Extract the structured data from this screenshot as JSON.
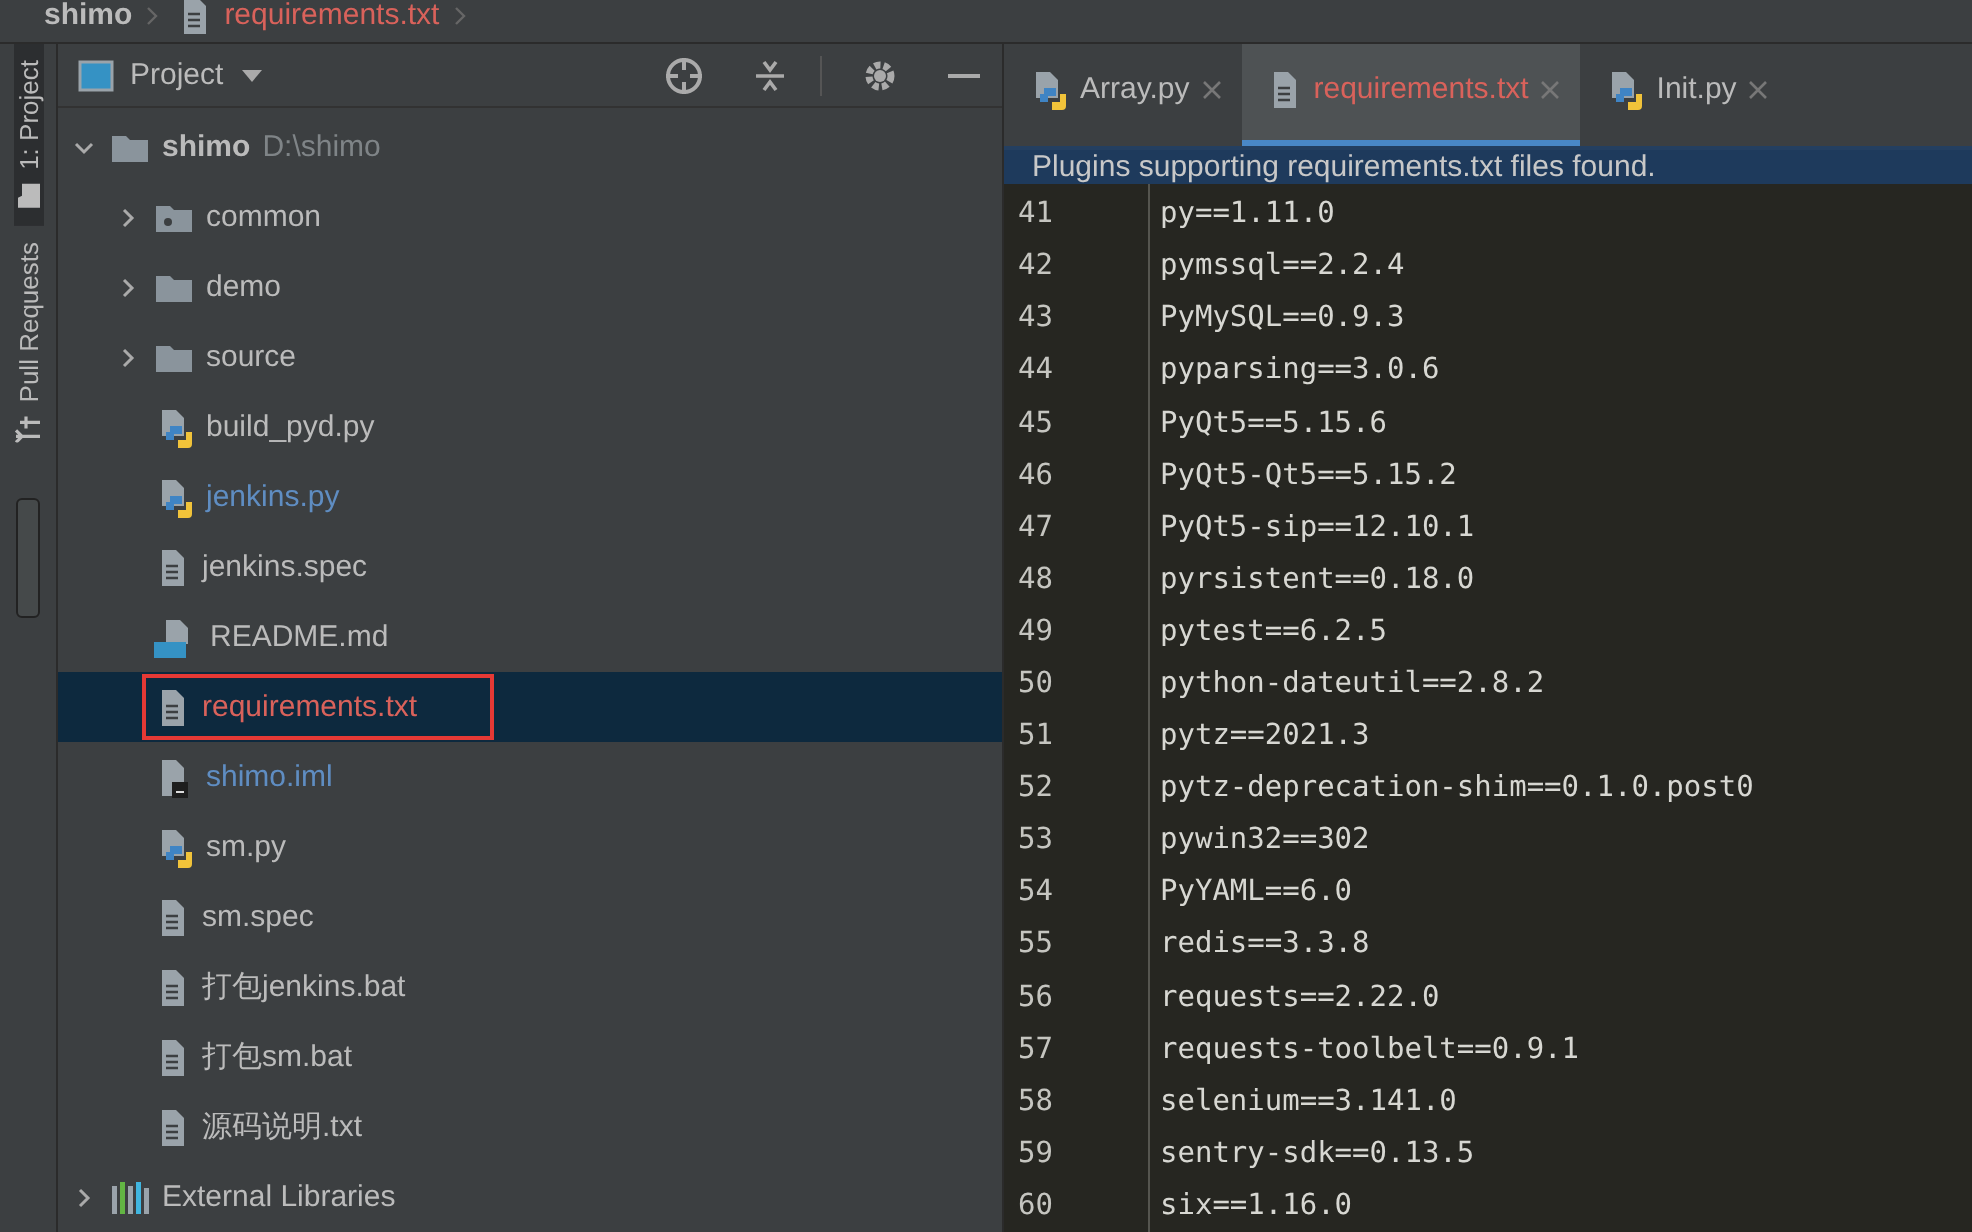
{
  "breadcrumb": [
    {
      "label": "shimo"
    },
    {
      "label": "requirements.txt",
      "kind": "text"
    }
  ],
  "tool_strip": [
    {
      "label": "1: Project",
      "kind": "project",
      "selected": true
    },
    {
      "label": "Pull Requests",
      "kind": "pull",
      "selected": false
    }
  ],
  "project_panel": {
    "title": "Project",
    "tree": [
      {
        "label": "shimo",
        "path": "D:\\shimo",
        "kind": "folder",
        "expanded": true,
        "selected": false,
        "children": [
          {
            "label": "common",
            "kind": "package",
            "expanded": false,
            "selected": false
          },
          {
            "label": "demo",
            "kind": "folder",
            "expanded": false,
            "selected": false
          },
          {
            "label": "source",
            "kind": "folder",
            "expanded": false,
            "selected": false
          },
          {
            "label": "build_pyd.py",
            "kind": "python",
            "selected": false
          },
          {
            "label": "jenkins.py",
            "kind": "python",
            "selected": false,
            "color": "#5f8dc2"
          },
          {
            "label": "jenkins.spec",
            "kind": "text",
            "selected": false
          },
          {
            "label": "README.md",
            "kind": "markdown",
            "selected": false
          },
          {
            "label": "requirements.txt",
            "kind": "text",
            "selected": true,
            "outlined": true,
            "color": "#d9625b"
          },
          {
            "label": "shimo.iml",
            "kind": "iml",
            "selected": false,
            "color": "#5f8dc2"
          },
          {
            "label": "sm.py",
            "kind": "python",
            "selected": false
          },
          {
            "label": "sm.spec",
            "kind": "text",
            "selected": false
          },
          {
            "label": "打包jenkins.bat",
            "kind": "text",
            "selected": false
          },
          {
            "label": "打包sm.bat",
            "kind": "text",
            "selected": false
          },
          {
            "label": "源码说明.txt",
            "kind": "text",
            "selected": false
          }
        ]
      },
      {
        "label": "External Libraries",
        "kind": "libraries",
        "expanded": false,
        "selected": false
      }
    ]
  },
  "editor": {
    "tabs": [
      {
        "label": "Array.py",
        "kind": "python",
        "selected": false
      },
      {
        "label": "requirements.txt",
        "kind": "text",
        "selected": true,
        "color": "#d9625b"
      },
      {
        "label": "Init.py",
        "kind": "python",
        "selected": false
      }
    ],
    "banner": "Plugins supporting requirements.txt files found.",
    "lines": [
      {
        "number": "41",
        "text": "py==1.11.0"
      },
      {
        "number": "42",
        "text": "pymssql==2.2.4"
      },
      {
        "number": "43",
        "text": "PyMySQL==0.9.3"
      },
      {
        "number": "44",
        "text": "pyparsing==3.0.6"
      },
      {
        "number": "45",
        "text": "PyQt5==5.15.6"
      },
      {
        "number": "46",
        "text": "PyQt5-Qt5==5.15.2"
      },
      {
        "number": "47",
        "text": "PyQt5-sip==12.10.1"
      },
      {
        "number": "48",
        "text": "pyrsistent==0.18.0"
      },
      {
        "number": "49",
        "text": "pytest==6.2.5"
      },
      {
        "number": "50",
        "text": "python-dateutil==2.8.2"
      },
      {
        "number": "51",
        "text": "pytz==2021.3"
      },
      {
        "number": "52",
        "text": "pytz-deprecation-shim==0.1.0.post0"
      },
      {
        "number": "53",
        "text": "pywin32==302"
      },
      {
        "number": "54",
        "text": "PyYAML==6.0"
      },
      {
        "number": "55",
        "text": "redis==3.3.8"
      },
      {
        "number": "56",
        "text": "requests==2.22.0"
      },
      {
        "number": "57",
        "text": "requests-toolbelt==0.9.1"
      },
      {
        "number": "58",
        "text": "selenium==3.141.0"
      },
      {
        "number": "59",
        "text": "sentry-sdk==0.13.5"
      },
      {
        "number": "60",
        "text": "six==1.16.0"
      }
    ]
  }
}
